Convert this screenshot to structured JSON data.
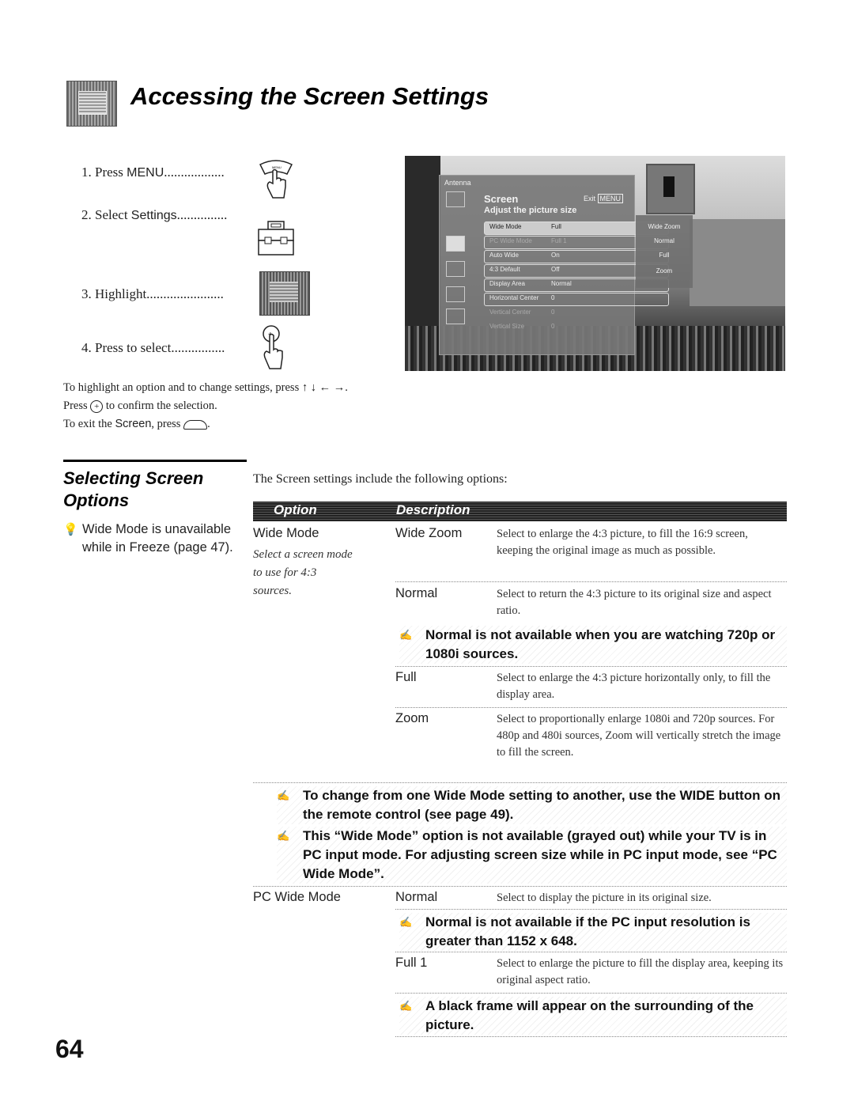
{
  "page": {
    "title": "Accessing the Screen Settings",
    "page_number": "64"
  },
  "steps": [
    {
      "num": "1.",
      "pre": "Press ",
      "key": "MENU",
      "dots": "..................",
      "icon": "menu-press-icon"
    },
    {
      "num": "2.",
      "pre": "Select ",
      "key": "Settings",
      "dots": "...............",
      "icon": "settings-toolbox-icon"
    },
    {
      "num": "3.",
      "pre": "Highlight",
      "key": "",
      "dots": ".......................",
      "icon": "screen-menu-icon"
    },
    {
      "num": "4.",
      "pre": "Press to select",
      "key": "",
      "dots": "................",
      "icon": "select-button-press-icon"
    }
  ],
  "tv_osd": {
    "source": "Antenna",
    "menu_title": "Screen",
    "exit_label": "Exit",
    "exit_key": "MENU",
    "subtitle": "Adjust the picture size",
    "rows": [
      {
        "label": "Wide Mode",
        "value": "Full",
        "state": "selected"
      },
      {
        "label": "PC Wide Mode",
        "value": "Full 1",
        "state": "dim"
      },
      {
        "label": "Auto Wide",
        "value": "On",
        "state": "normal"
      },
      {
        "label": "4:3 Default",
        "value": "Off",
        "state": "normal"
      },
      {
        "label": "Display Area",
        "value": "Normal",
        "state": "normal"
      },
      {
        "label": "Horizontal Center",
        "value": "0",
        "state": "normal"
      },
      {
        "label": "Vertical Center",
        "value": "0",
        "state": "dim"
      },
      {
        "label": "Vertical Size",
        "value": "0",
        "state": "dim"
      }
    ],
    "submenu": [
      "Wide Zoom",
      "Normal",
      "Full",
      "Zoom"
    ]
  },
  "instructions": {
    "line1": "To highlight an option and to change settings, press",
    "arrows": "↑ ↓ ← →.",
    "line2_pre": "Press",
    "line2_post": "to confirm the selection.",
    "line3_pre": "To exit the",
    "line3_key": "Screen",
    "line3_post": ", press",
    "line3_end": "."
  },
  "section": {
    "title": "Selecting Screen Options",
    "hint": "Wide Mode is unavailable while in Freeze (page 47)."
  },
  "options": {
    "intro": "The Screen settings include the following options:",
    "header": {
      "option": "Option",
      "description": "Description"
    },
    "wide_mode": {
      "name": "Wide Mode",
      "note": "Select a screen mode to use for 4:3 sources.",
      "items": [
        {
          "value": "Wide Zoom",
          "desc": "Select to enlarge the 4:3 picture, to fill the 16:9 screen, keeping the original image as much as possible."
        },
        {
          "value": "Normal",
          "desc": "Select to return the 4:3 picture to its original size and aspect ratio."
        },
        {
          "value": "Full",
          "desc": "Select to enlarge the 4:3 picture horizontally only, to fill the display area."
        },
        {
          "value": "Zoom",
          "desc": "Select to proportionally enlarge 1080i and 720p sources. For 480p and 480i sources, Zoom will vertically stretch the image to fill the screen."
        }
      ],
      "note_normal": "Normal is not available when you are watching 720p or 1080i sources.",
      "notes_after": [
        "To change from one Wide Mode setting to another, use the WIDE button on the remote control (see page 49).",
        "This “Wide Mode” option is not available (grayed out) while your TV is in PC input mode. For adjusting screen size while in PC input mode, see “PC Wide Mode”."
      ]
    },
    "pc_wide_mode": {
      "name": "PC Wide Mode",
      "items": [
        {
          "value": "Normal",
          "desc": "Select to display the picture in its original size."
        },
        {
          "value": "Full 1",
          "desc": "Select to enlarge the picture to fill the display area, keeping its original aspect ratio."
        }
      ],
      "note_normal": "Normal is not available if the PC input resolution is greater than 1152 x 648.",
      "note_full": "A black frame will appear on the surrounding of the picture."
    }
  }
}
